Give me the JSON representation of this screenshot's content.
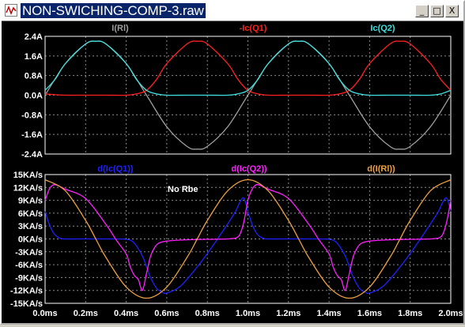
{
  "window": {
    "title": "NON-SWICHING-COMP-3.raw",
    "minimize_label": "_",
    "maximize_label": "□",
    "close_label": "X"
  },
  "chart_data": [
    {
      "type": "line",
      "title": "",
      "grid": true,
      "ylim": [
        -2.4,
        2.4
      ],
      "xlim": [
        0,
        2.0
      ],
      "y_ticks": [
        "2.4A",
        "1.6A",
        "0.8A",
        "0.0A",
        "-0.8A",
        "-1.6A",
        "-2.4A"
      ],
      "x_ticks": [],
      "series": [
        {
          "name": "I(Rl)",
          "color": "#a0a0a0",
          "x": [
            0,
            0.1,
            0.2,
            0.25,
            0.3,
            0.4,
            0.5,
            0.6,
            0.7,
            0.75,
            0.8,
            0.9,
            1.0,
            1.1,
            1.2,
            1.25,
            1.3,
            1.4,
            1.5,
            1.6,
            1.7,
            1.75,
            1.8,
            1.9,
            2.0
          ],
          "values": [
            0,
            1.29,
            2.09,
            2.2,
            2.09,
            1.29,
            0,
            -1.29,
            -2.09,
            -2.2,
            -2.09,
            -1.29,
            0,
            1.29,
            2.09,
            2.2,
            2.09,
            1.29,
            0,
            -1.29,
            -2.09,
            -2.2,
            -2.09,
            -1.29,
            0
          ]
        },
        {
          "name": "-Ic(Q1)",
          "color": "#ff2020",
          "x": [
            0,
            0.05,
            0.1,
            0.2,
            0.3,
            0.4,
            0.45,
            0.5,
            0.55,
            0.6,
            0.7,
            0.75,
            0.8,
            0.9,
            0.95,
            1.0,
            1.05,
            1.1,
            1.2,
            1.3,
            1.4,
            1.45,
            1.5,
            1.55,
            1.6,
            1.7,
            1.75,
            1.8,
            1.9,
            1.95,
            2.0
          ],
          "values": [
            0.05,
            0.02,
            0,
            0,
            0,
            0,
            0.05,
            0.2,
            0.65,
            1.29,
            2.09,
            2.2,
            2.09,
            1.29,
            0.65,
            0.2,
            0.05,
            0,
            0,
            0,
            0,
            0.05,
            0.2,
            0.65,
            1.29,
            2.09,
            2.2,
            2.09,
            1.29,
            0.65,
            0.2
          ]
        },
        {
          "name": "Ic(Q2)",
          "color": "#40e0e0",
          "x": [
            0,
            0.05,
            0.1,
            0.2,
            0.25,
            0.3,
            0.4,
            0.45,
            0.5,
            0.55,
            0.6,
            0.7,
            0.8,
            0.9,
            0.95,
            1.0,
            1.05,
            1.1,
            1.2,
            1.25,
            1.3,
            1.4,
            1.45,
            1.5,
            1.55,
            1.6,
            1.7,
            1.8,
            1.9,
            1.95,
            2.0
          ],
          "values": [
            0.2,
            0.65,
            1.29,
            2.09,
            2.2,
            2.09,
            1.29,
            0.65,
            0.2,
            0.05,
            0,
            0,
            0,
            0,
            0.05,
            0.2,
            0.65,
            1.29,
            2.09,
            2.2,
            2.09,
            1.29,
            0.65,
            0.2,
            0.05,
            0,
            0,
            0,
            0,
            0.05,
            0.2
          ]
        }
      ]
    },
    {
      "type": "line",
      "title": "",
      "annotation": "No Rbe",
      "grid": true,
      "ylim": [
        -15,
        15
      ],
      "xlim": [
        0,
        2.0
      ],
      "y_ticks": [
        "15KA/s",
        "12KA/s",
        "9KA/s",
        "6KA/s",
        "3KA/s",
        "0KA/s",
        "-3KA/s",
        "-6KA/s",
        "-9KA/s",
        "-12KA/s",
        "-15KA/s"
      ],
      "x_ticks": [
        "0.0ms",
        "0.2ms",
        "0.4ms",
        "0.6ms",
        "0.8ms",
        "1.0ms",
        "1.2ms",
        "1.4ms",
        "1.6ms",
        "1.8ms",
        "2.0ms"
      ],
      "series": [
        {
          "name": "d(Ic(Q1))",
          "color": "#2020ff",
          "x": [
            0,
            0.02,
            0.04,
            0.06,
            0.08,
            0.1,
            0.2,
            0.3,
            0.4,
            0.44,
            0.48,
            0.5,
            0.52,
            0.55,
            0.58,
            0.6,
            0.65,
            0.7,
            0.8,
            0.9,
            0.94,
            0.96,
            0.98,
            1.0,
            1.02,
            1.04,
            1.06,
            1.08,
            1.1,
            1.2,
            1.3,
            1.4,
            1.44,
            1.48,
            1.5,
            1.52,
            1.55,
            1.58,
            1.6,
            1.65,
            1.7,
            1.8,
            1.9,
            1.94,
            1.96,
            1.98,
            2.0
          ],
          "values": [
            6.4,
            3.5,
            1.5,
            0.5,
            0.1,
            0,
            0,
            0,
            -0.1,
            -1,
            -4,
            -6.5,
            -9,
            -11.5,
            -12.5,
            -12.6,
            -11.6,
            -9.4,
            -3.4,
            3.5,
            6.5,
            8.5,
            9.5,
            6.4,
            3.5,
            1.5,
            0.5,
            0.1,
            0,
            0,
            0,
            -0.1,
            -1,
            -4,
            -6.5,
            -9,
            -11.5,
            -12.5,
            -12.6,
            -11.6,
            -9.4,
            -3.4,
            3.5,
            6.5,
            8.5,
            9.5,
            6.4
          ]
        },
        {
          "name": "d(Ic(Q2))",
          "color": "#ff20ff",
          "x": [
            0,
            0.02,
            0.04,
            0.06,
            0.1,
            0.2,
            0.3,
            0.35,
            0.4,
            0.42,
            0.44,
            0.46,
            0.48,
            0.5,
            0.52,
            0.54,
            0.56,
            0.6,
            0.7,
            0.8,
            0.9,
            0.92,
            0.94,
            0.96,
            0.98,
            1.0,
            1.02,
            1.04,
            1.06,
            1.1,
            1.2,
            1.3,
            1.35,
            1.4,
            1.42,
            1.44,
            1.46,
            1.48,
            1.5,
            1.52,
            1.54,
            1.56,
            1.6,
            1.7,
            1.8,
            1.9,
            1.92,
            1.94,
            1.96,
            1.98,
            2.0
          ],
          "values": [
            9,
            11.5,
            12.6,
            12.5,
            11.6,
            9.4,
            3.4,
            -0.2,
            -3.5,
            -6.5,
            -8.5,
            -9.5,
            -12,
            -8,
            -4,
            -2,
            -1,
            -0.5,
            -0.2,
            -0.1,
            0,
            0.1,
            0.2,
            1,
            4,
            9,
            11.5,
            12.6,
            12.5,
            11.6,
            9.4,
            3.4,
            -0.2,
            -3.5,
            -6.5,
            -8.5,
            -9.5,
            -12,
            -8,
            -4,
            -2,
            -1,
            -0.5,
            -0.2,
            -0.1,
            0,
            0.1,
            0.2,
            1,
            4,
            9
          ]
        },
        {
          "name": "d(I(Rl))",
          "color": "#f0a040",
          "x": [
            0,
            0.1,
            0.2,
            0.25,
            0.3,
            0.4,
            0.5,
            0.6,
            0.7,
            0.75,
            0.8,
            0.9,
            1.0,
            1.1,
            1.2,
            1.25,
            1.3,
            1.4,
            1.5,
            1.6,
            1.7,
            1.75,
            1.8,
            1.9,
            2.0
          ],
          "values": [
            13.8,
            11.2,
            4.3,
            0,
            -4.3,
            -11.2,
            -13.8,
            -11.2,
            -4.3,
            0,
            4.3,
            11.2,
            13.8,
            11.2,
            4.3,
            0,
            -4.3,
            -11.2,
            -13.8,
            -11.2,
            -4.3,
            0,
            4.3,
            11.2,
            13.8
          ]
        }
      ]
    }
  ]
}
